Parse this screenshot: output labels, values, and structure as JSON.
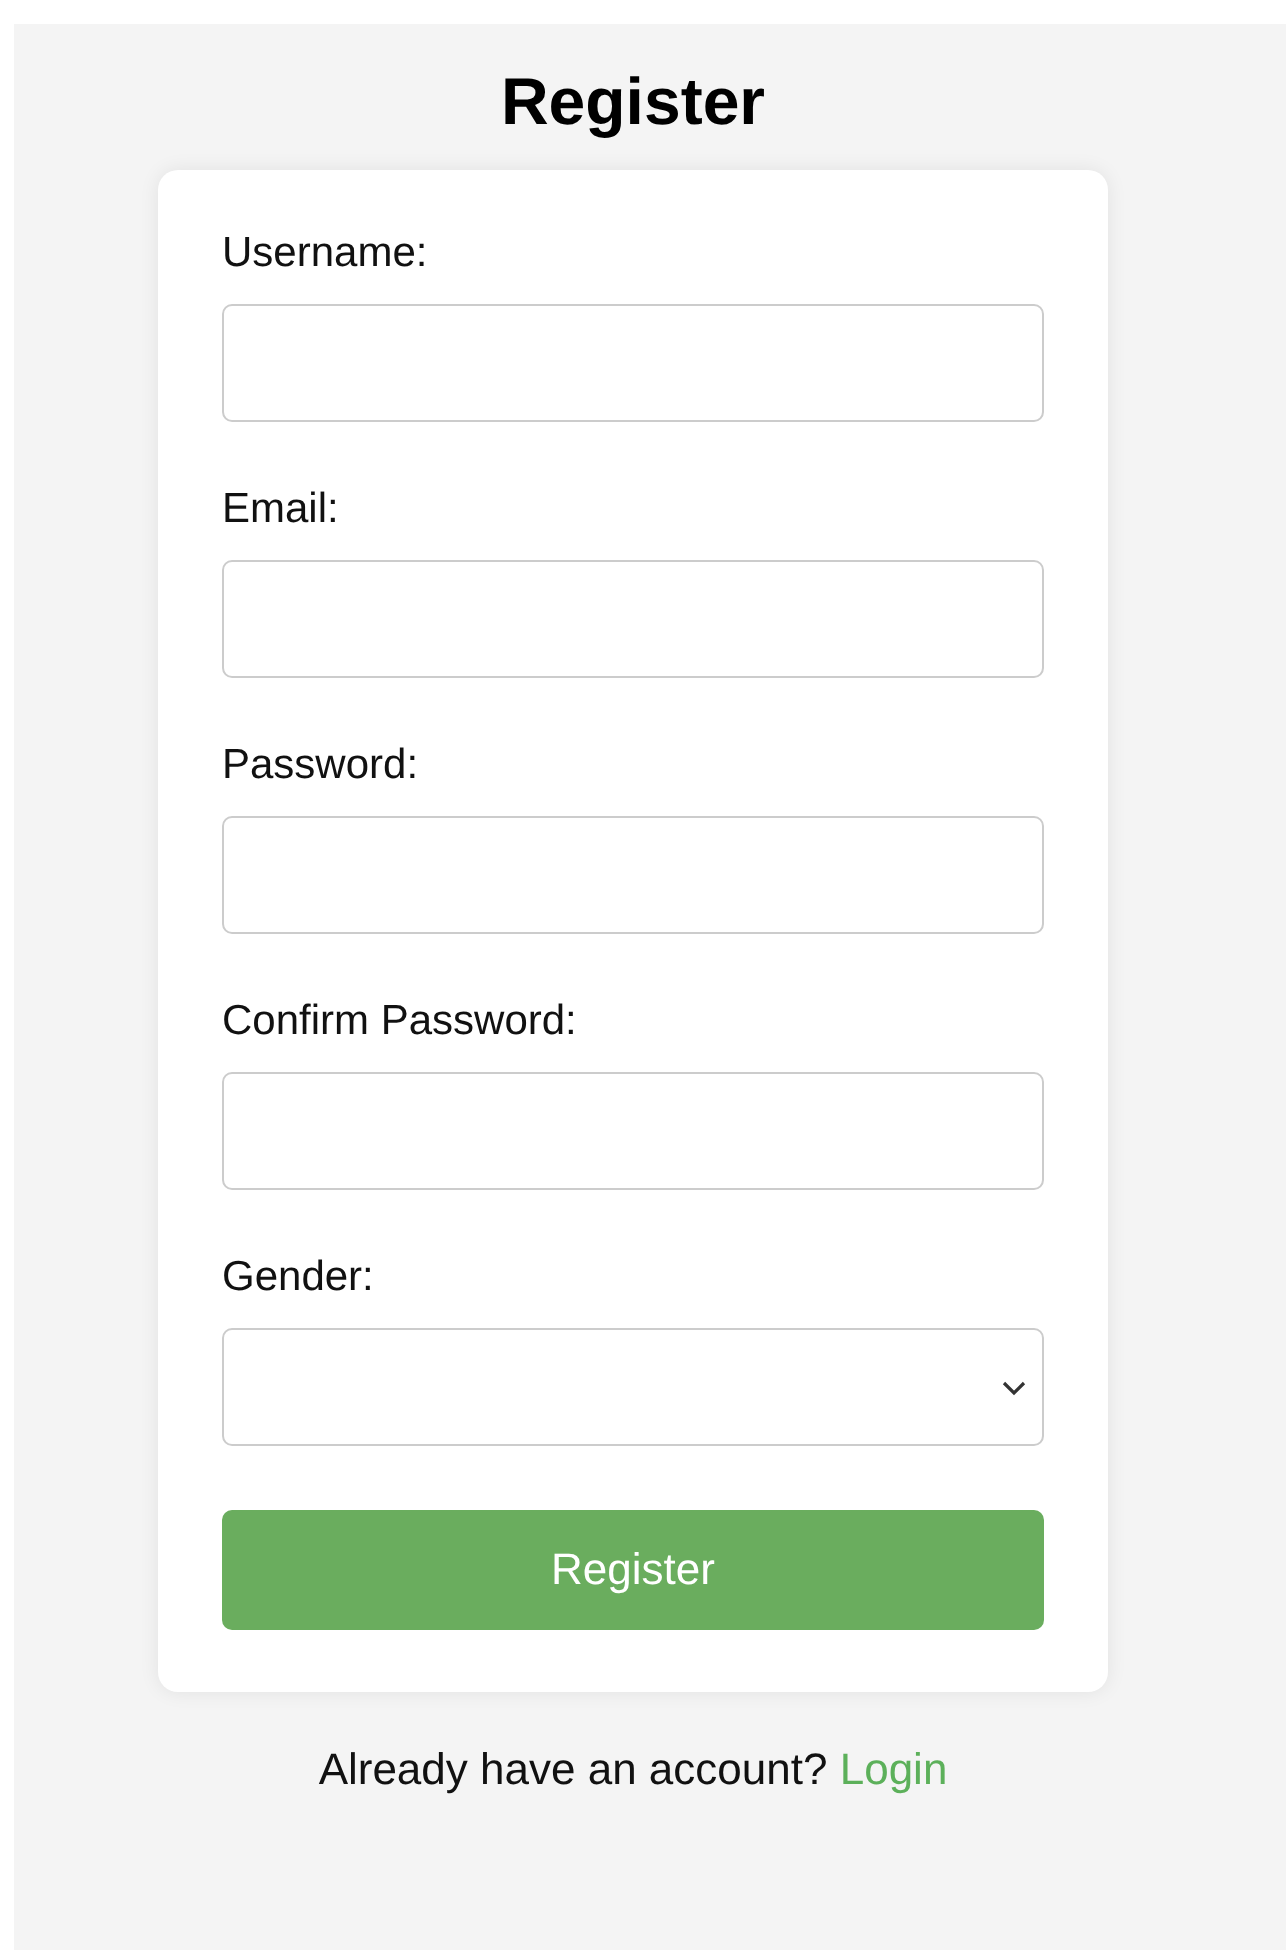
{
  "title": "Register",
  "fields": [
    {
      "kind": "text",
      "label": "Username:"
    },
    {
      "kind": "email",
      "label": "Email:"
    },
    {
      "kind": "password",
      "label": "Password:"
    },
    {
      "kind": "password",
      "label": "Confirm Password:"
    },
    {
      "kind": "select",
      "label": "Gender:"
    }
  ],
  "submit": "Register",
  "footer": {
    "text": "Already have an account?",
    "link": "Login"
  }
}
